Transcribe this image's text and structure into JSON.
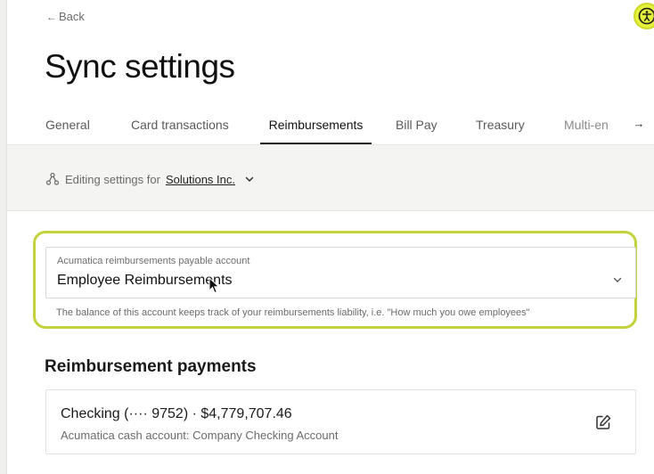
{
  "nav": {
    "back_label": "Back",
    "back_arrow": "←"
  },
  "accessibility": {
    "icon": "accessibility-icon",
    "color": "#e4f03a"
  },
  "page": {
    "title": "Sync settings"
  },
  "tabs": [
    {
      "label": "General",
      "active": false
    },
    {
      "label": "Card transactions",
      "active": false
    },
    {
      "label": "Reimbursements",
      "active": true
    },
    {
      "label": "Bill Pay",
      "active": false
    },
    {
      "label": "Treasury",
      "active": false
    },
    {
      "label": "Multi-en",
      "active": false
    }
  ],
  "tabs_scroll": {
    "glyph": "→"
  },
  "entity": {
    "prefix": "Editing settings for",
    "name": "Solutions Inc."
  },
  "payable_account": {
    "label": "Acumatica reimbursements payable account",
    "value": "Employee Reimbursements",
    "helper": "The balance of this account keeps track of your reimbursements liability, i.e. \"How much you owe employees\"",
    "highlight_color": "#c3d23b"
  },
  "reimbursement_payments": {
    "title": "Reimbursement payments",
    "account_title": "Checking (···· 9752) · $4,779,707.46",
    "account_subtitle": "Acumatica cash account: Company Checking Account"
  }
}
